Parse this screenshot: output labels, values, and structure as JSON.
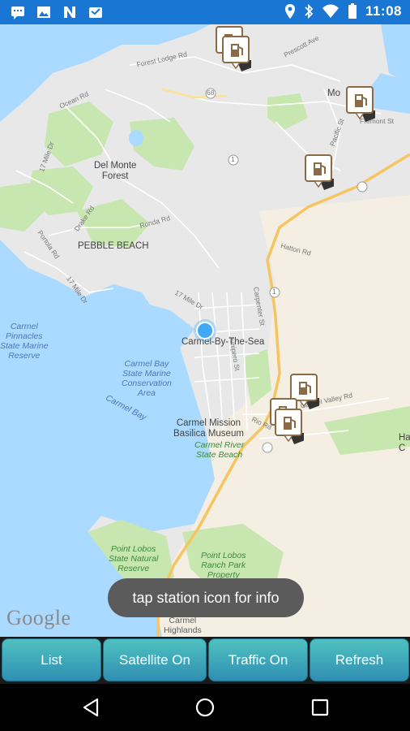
{
  "status_bar": {
    "time": "11:08",
    "left_icons": [
      "message-icon",
      "image-icon",
      "n-icon",
      "inbox-icon"
    ],
    "right_icons": [
      "location-icon",
      "bluetooth-icon",
      "wifi-icon",
      "battery-icon"
    ]
  },
  "map": {
    "labels": {
      "del_monte_forest": "Del Monte\nForest",
      "pebble_beach": "PEBBLE BEACH",
      "carmel_pinnacles": "Carmel\nPinnacles\nState Marine\nReserve",
      "carmel_by_the_sea": "Carmel-By-The-Sea",
      "carmel_bay_conservation": "Carmel Bay\nState Marine\nConservation\nArea",
      "carmel_bay": "Carmel Bay",
      "carmel_mission": "Carmel Mission\nBasilica Museum",
      "carmel_river": "Carmel River\nState Beach",
      "point_lobos_reserve": "Point Lobos\nState Natural\nReserve",
      "point_lobos_ranch": "Point Lobos\nRanch Park\nProperty",
      "carmel_highlands": "Carmel\nHighlands",
      "monterey_partial": "Mo",
      "ha_partial": "Ha\nC",
      "forest_lodge_rd": "Forest Lodge Rd",
      "prescott_ave": "Prescott Ave",
      "ocean_rd": "Ocean Rd",
      "ronda_rd": "Ronda Rd",
      "drake_rd": "Drake Rd",
      "portola_rd": "Portola Rd",
      "seventeen_mile_dr": "17 Mile Dr",
      "seventeen_mile_dr_2": "17 Mile Dr",
      "seventeen_mile_dr_3": "17 Mile Dr",
      "carmel_valley_rd": "Carmel Valley Rd",
      "rio_rd": "Rio Rd",
      "carpenter_st": "Carpenter St",
      "junipero_st": "Junipero St",
      "hatton_rd": "Hatton Rd",
      "pacific_st": "Pacific St",
      "fremont_st": "Fremont St",
      "route_1": "1",
      "route_68": "68",
      "route_1b": "1"
    },
    "attribution": "Google"
  },
  "toast": {
    "text": "tap station icon for info"
  },
  "buttons": {
    "list": "List",
    "satellite": "Satellite On",
    "traffic": "Traffic On",
    "refresh": "Refresh"
  },
  "colors": {
    "status_bar": "#1976d2",
    "water": "#aadaff",
    "land": "#e8e8e8",
    "park": "#c8e6b0",
    "sand": "#f4efe2",
    "highway": "#f6c560",
    "button_top": "#4fc1c0",
    "button_bottom": "#2f8fb2"
  }
}
